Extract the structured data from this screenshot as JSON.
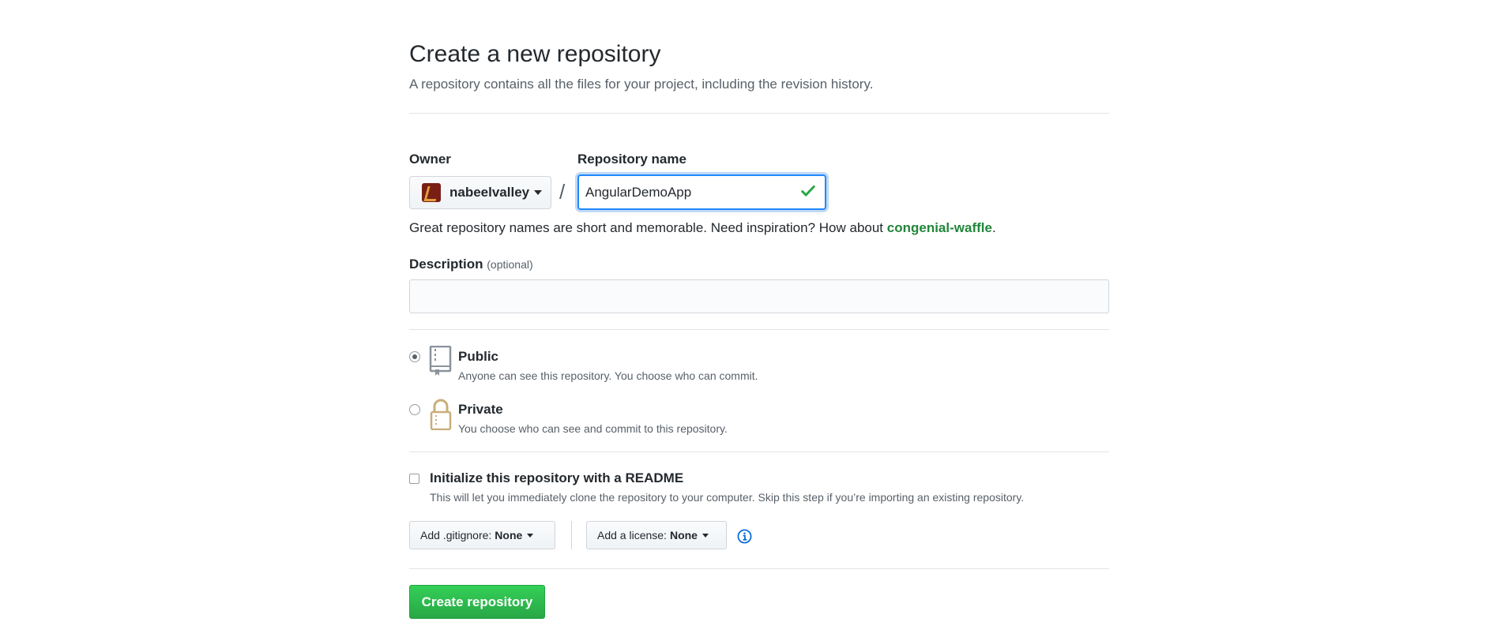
{
  "header": {
    "title": "Create a new repository",
    "subtitle": "A repository contains all the files for your project, including the revision history."
  },
  "owner": {
    "label": "Owner",
    "selected": "nabeelvalley",
    "avatar": "avatar-icon"
  },
  "separator": "/",
  "repo_name": {
    "label": "Repository name",
    "value": "AngularDemoApp",
    "valid_icon": "check-icon",
    "accent_color": "#2188ff"
  },
  "hint": {
    "text": "Great repository names are short and memorable. Need inspiration? How about ",
    "suggestion": "congenial-waffle",
    "suffix": "."
  },
  "description": {
    "label": "Description",
    "optional_text": "(optional)",
    "value": "",
    "placeholder": ""
  },
  "visibility": {
    "selected": "public",
    "options": [
      {
        "id": "public",
        "label": "Public",
        "note": "Anyone can see this repository. You choose who can commit.",
        "icon": "repo-book-icon"
      },
      {
        "id": "private",
        "label": "Private",
        "note": "You choose who can see and commit to this repository.",
        "icon": "lock-icon"
      }
    ]
  },
  "readme": {
    "checked": false,
    "label": "Initialize this repository with a README",
    "note": "This will let you immediately clone the repository to your computer. Skip this step if you’re importing an existing repository."
  },
  "gitignore": {
    "prefix": "Add .gitignore:",
    "value": "None"
  },
  "license": {
    "prefix": "Add a license:",
    "value": "None"
  },
  "info_icon": "info-icon",
  "submit": {
    "label": "Create repository",
    "color": "#28a745"
  }
}
